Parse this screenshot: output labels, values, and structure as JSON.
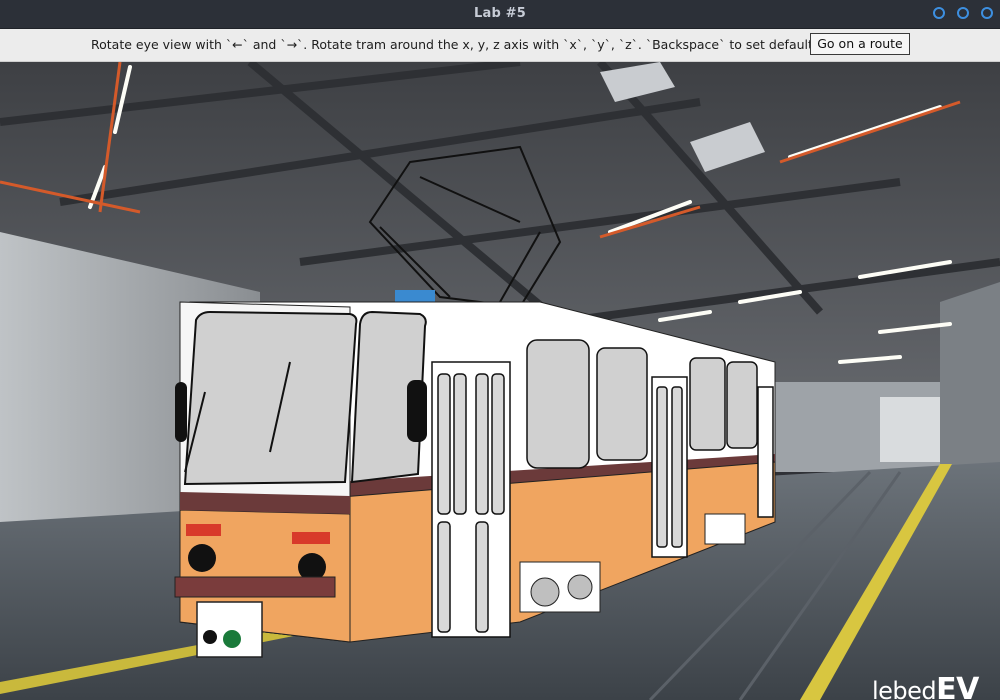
{
  "window": {
    "title": "Lab #5"
  },
  "toolbar": {
    "instructions": "Rotate eye view with `←` and `→`. Rotate tram around the x, y, z axis with `x`, `y`, `z`. `Backspace` to set default",
    "route_button_label": "Go on a route"
  },
  "scene": {
    "watermark": {
      "prefix": "lebed",
      "suffix": "EV"
    },
    "colors": {
      "ceiling": "#4a4c50",
      "floor": "#4b5259",
      "tram_body_lower": "#f0a560",
      "tram_body_upper": "#ffffff",
      "tram_stripe": "#6b3a3a",
      "window_glass": "#d0d0d0",
      "lane_line": "#d8c640",
      "ceiling_beams": "#d45a2a"
    }
  },
  "icons": {
    "minimize": "circle-icon",
    "maximize": "circle-icon",
    "close": "circle-icon"
  }
}
